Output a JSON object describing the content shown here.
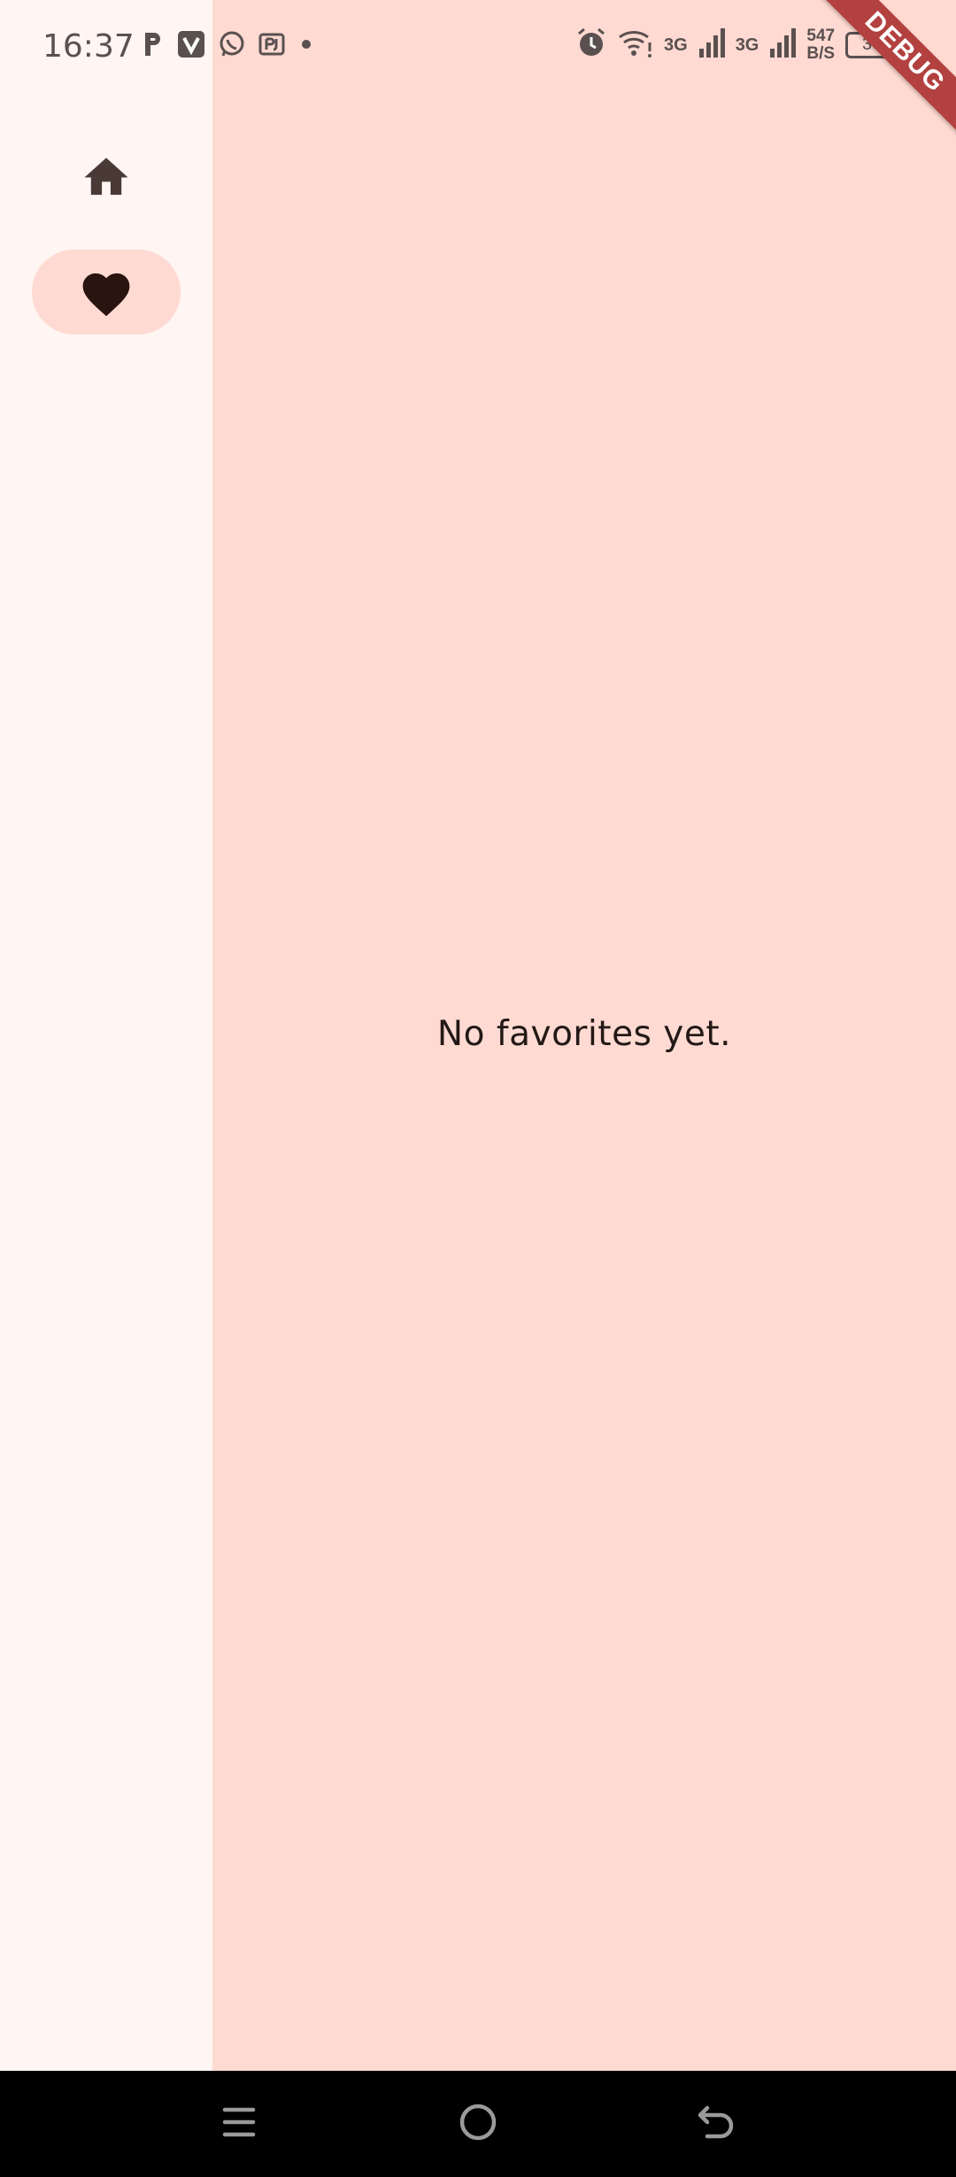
{
  "status_bar": {
    "time": "16:37",
    "left_icons": [
      "p-icon",
      "v-icon",
      "whatsapp-icon",
      "pj-icon",
      "dot-icon"
    ],
    "net1": "3G",
    "net2": "3G",
    "speed_value": "547",
    "speed_unit": "B/S",
    "battery": "36"
  },
  "debug_banner": "DEBUG",
  "navigation_rail": {
    "items": [
      {
        "icon": "home-icon",
        "selected": false
      },
      {
        "icon": "heart-icon",
        "selected": true
      }
    ]
  },
  "content": {
    "message": "No favorites yet."
  },
  "colors": {
    "background": "#FFDAD2",
    "rail_background": "#FFF5F3",
    "indicator": "#FFDAD2",
    "text": "#231917",
    "ribbon": "#B3413F"
  }
}
